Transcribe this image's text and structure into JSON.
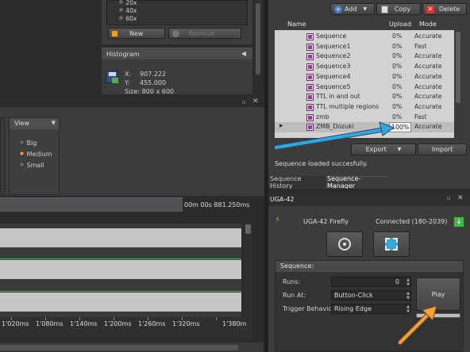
{
  "zoom_panel": {
    "options": [
      "20x",
      "40x",
      "60x"
    ],
    "new_label": "New",
    "remove_label": "Remove"
  },
  "histogram": {
    "title": "Histogram",
    "x_label": "X:",
    "x_value": "907.222",
    "y_label": "Y:",
    "y_value": "455.000",
    "size_label": "Size: 800 x 600"
  },
  "view_panel": {
    "title": "View",
    "options": [
      "Big",
      "Medium",
      "Small"
    ],
    "selected": "Medium"
  },
  "timeline": {
    "time_readout": "00m 00s 881.250ms",
    "ticks": [
      "1'020ms",
      "1'080ms",
      "1'140ms",
      "1'200ms",
      "1'260ms",
      "1'320ms",
      "1'380m"
    ]
  },
  "sequence_manager": {
    "add_label": "Add",
    "copy_label": "Copy",
    "delete_label": "Delete",
    "columns": [
      "Name",
      "Upload",
      "Mode"
    ],
    "rows": [
      {
        "name": "Sequence",
        "upload": "0%",
        "mode": "Accurate"
      },
      {
        "name": "Sequence1",
        "upload": "0%",
        "mode": "Fast"
      },
      {
        "name": "Sequence2",
        "upload": "0%",
        "mode": "Accurate"
      },
      {
        "name": "Sequence3",
        "upload": "0%",
        "mode": "Accurate"
      },
      {
        "name": "Sequence4",
        "upload": "0%",
        "mode": "Accurate"
      },
      {
        "name": "Sequence5",
        "upload": "0%",
        "mode": "Accurate"
      },
      {
        "name": "TTL in and out",
        "upload": "0%",
        "mode": "Accurate"
      },
      {
        "name": "TTL multiple regions",
        "upload": "0%",
        "mode": "Accurate"
      },
      {
        "name": "zmb",
        "upload": "0%",
        "mode": "Fast"
      },
      {
        "name": "ZMB_Dozuki",
        "upload": "100%",
        "mode": "Accurate"
      }
    ],
    "export_label": "Export",
    "import_label": "Import",
    "status": "Sequence loaded succesfully.",
    "tabs": [
      "Sequence History",
      "Sequence-Manager"
    ],
    "active_tab": "Sequence-Manager"
  },
  "device": {
    "title": "UGA-42",
    "name": "UGA-42 Firefly",
    "status": "Connected (180-2039)",
    "sequence_header": "Sequence:",
    "runs_label": "Runs:",
    "runs_value": "0",
    "run_at_label": "Run At:",
    "run_at_value": "Button-Click",
    "trigger_label": "Trigger Behavior:",
    "trigger_value": "Rising Edge",
    "play_label": "Play"
  },
  "colors": {
    "background": "#2b2b2b",
    "panel": "#3c3c3c",
    "annotation_arrow_blue": "#3aa3d8",
    "annotation_arrow_orange": "#f0a040",
    "green_line": "#4caf50",
    "sequence_icon": "#9b3c9b"
  }
}
